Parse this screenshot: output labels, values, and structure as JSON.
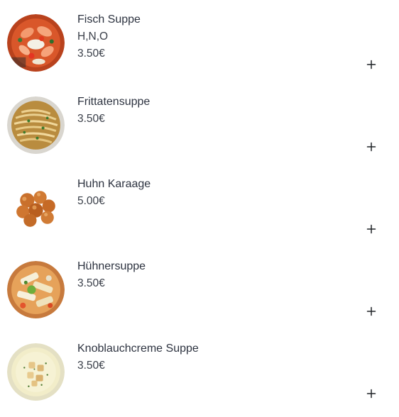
{
  "menu": {
    "items": [
      {
        "name": "Fisch Suppe",
        "allergens": "H,N,O",
        "price": "3.50€",
        "image_icon": "fish-soup-image",
        "add_icon": "plus-icon"
      },
      {
        "name": "Frittatensuppe",
        "price": "3.50€",
        "image_icon": "frittatensuppe-image",
        "add_icon": "plus-icon"
      },
      {
        "name": "Huhn Karaage",
        "price": "5.00€",
        "image_icon": "chicken-karaage-image",
        "add_icon": "plus-icon"
      },
      {
        "name": "Hühnersuppe",
        "price": "3.50€",
        "image_icon": "chicken-soup-image",
        "add_icon": "plus-icon"
      },
      {
        "name": "Knoblauchcreme Suppe",
        "price": "3.50€",
        "image_icon": "garlic-cream-soup-image",
        "add_icon": "plus-icon"
      }
    ]
  }
}
